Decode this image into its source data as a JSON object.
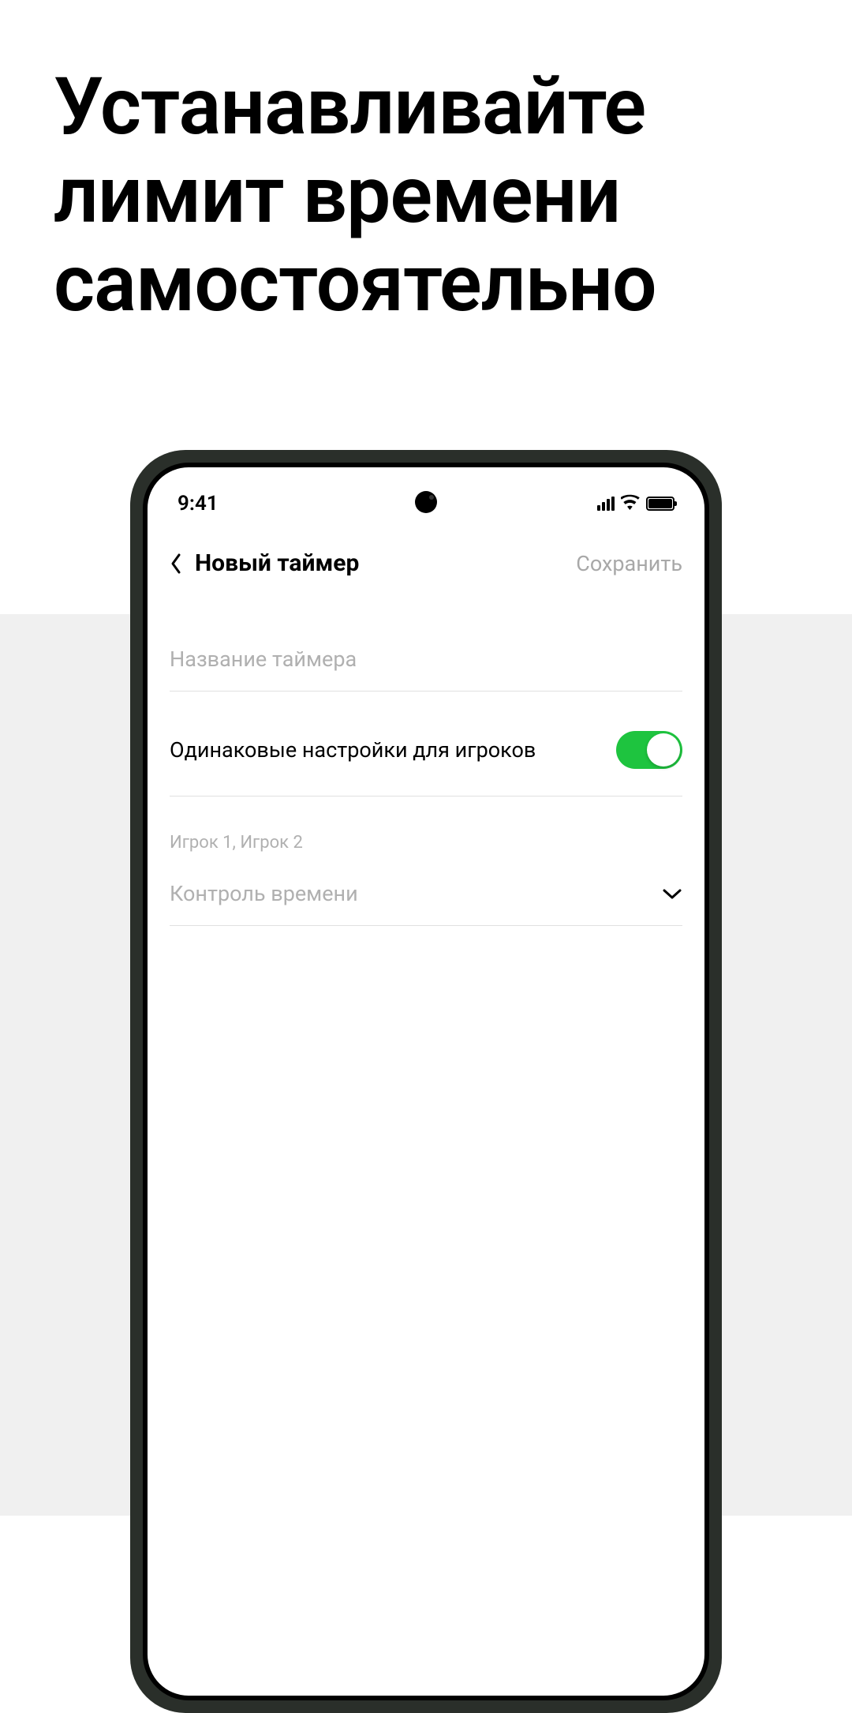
{
  "hero": {
    "title": "Устанавливайте лимит времени самостоятельно"
  },
  "statusBar": {
    "time": "9:41"
  },
  "header": {
    "title": "Новый таймер",
    "saveLabel": "Сохранить"
  },
  "form": {
    "nameInput": {
      "placeholder": "Название таймера"
    },
    "sameSettings": {
      "label": "Одинаковые настройки для игроков",
      "enabled": true
    },
    "playersLabel": "Игрок 1, Игрок 2",
    "timeControl": {
      "label": "Контроль времени"
    }
  }
}
